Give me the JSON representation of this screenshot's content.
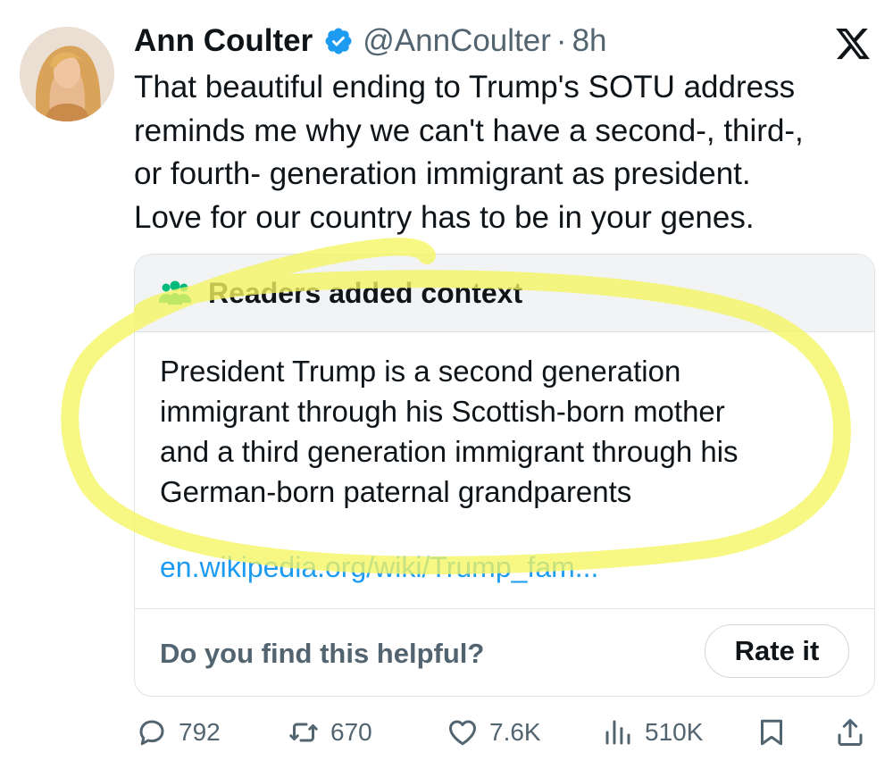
{
  "tweet": {
    "author_name": "Ann Coulter",
    "handle": "@AnnCoulter",
    "separator": "·",
    "time": "8h",
    "text_lines": [
      "That beautiful ending to Trump's SOTU address",
      "reminds me why we can't have a second-, third-,",
      "or fourth- generation immigrant as president.",
      "Love for our country has to be in your genes."
    ]
  },
  "note": {
    "title": "Readers added context",
    "body_lines": [
      "President Trump is a second generation",
      "immigrant through his Scottish-born mother",
      "and a third generation immigrant through his",
      "German-born paternal grandparents"
    ],
    "link": "en.wikipedia.org/wiki/Trump_fam...",
    "helpful_prompt": "Do you find this helpful?",
    "rate_label": "Rate it"
  },
  "actions": {
    "replies": "792",
    "reposts": "670",
    "likes": "7.6K",
    "views": "510K"
  },
  "icons": {
    "verified": "verified-badge-icon",
    "platform": "x-logo-icon",
    "note": "people-icon",
    "reply": "reply-icon",
    "repost": "repost-icon",
    "like": "heart-icon",
    "views": "views-icon",
    "bookmark": "bookmark-icon",
    "share": "share-icon"
  },
  "colors": {
    "text": "#0f1419",
    "muted": "#536471",
    "link": "#1d9bf0",
    "verified": "#1d9bf0",
    "note_icon": "#00ba7c",
    "highlight": "#f5f560"
  }
}
